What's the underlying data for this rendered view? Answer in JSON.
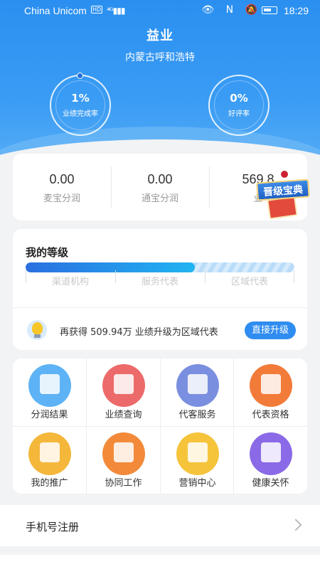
{
  "status_bar": {
    "carrier": "China Unicom",
    "network": "HD",
    "signal": "⁴ᴳ▮▮▮",
    "icons": "👁 N 🔕",
    "time": "18:29"
  },
  "header": {
    "name": "益业",
    "location": "内蒙古呼和浩特"
  },
  "rings": [
    {
      "value": "1%",
      "label": "业绩完成率"
    },
    {
      "value": "0%",
      "label": "好评率"
    }
  ],
  "stats": [
    {
      "value": "0.00",
      "label": "麦宝分润"
    },
    {
      "value": "0.00",
      "label": "通宝分润"
    },
    {
      "value": "569.8",
      "label": "业"
    }
  ],
  "badge": {
    "label": "晋级宝典"
  },
  "level": {
    "title": "我的等级",
    "progress_percent": 63,
    "tiers": [
      "渠道机构",
      "服务代表",
      "区域代表"
    ],
    "upgrade_text": "再获得 509.94万 业绩升级为区域代表",
    "upgrade_button": "直接升级"
  },
  "grid": [
    {
      "label": "分润结果",
      "icon": "wallet-icon",
      "color": "#5db3f5"
    },
    {
      "label": "业绩查询",
      "icon": "chart-icon",
      "color": "#ec6a6a"
    },
    {
      "label": "代客服务",
      "icon": "document-icon",
      "color": "#7b8fe0"
    },
    {
      "label": "代表资格",
      "icon": "robot-icon",
      "color": "#f27b3a"
    },
    {
      "label": "我的推广",
      "icon": "megaphone-icon",
      "color": "#f4b73a"
    },
    {
      "label": "协同工作",
      "icon": "building-icon",
      "color": "#f28a3a"
    },
    {
      "label": "营销中心",
      "icon": "house-icon",
      "color": "#f5c43b"
    },
    {
      "label": "健康关怀",
      "icon": "health-icon",
      "color": "#8a6ae6"
    }
  ],
  "phone_row": {
    "label": "手机号注册"
  }
}
